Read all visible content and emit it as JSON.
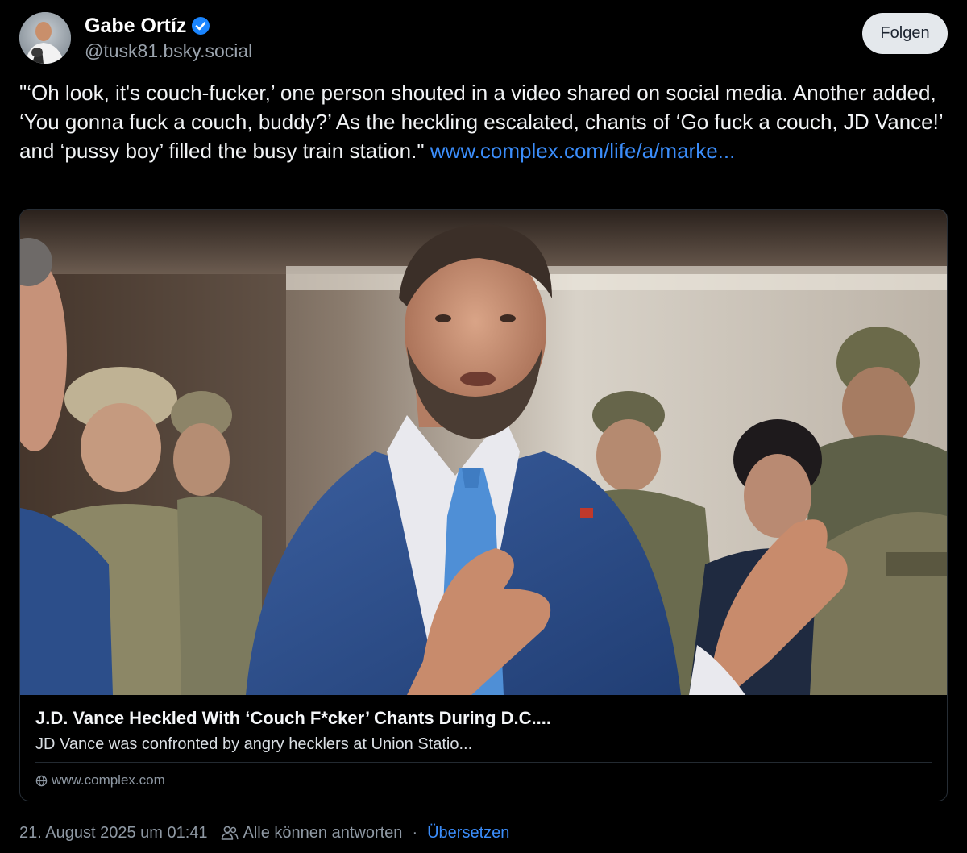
{
  "author": {
    "display_name": "Gabe Ortíz",
    "handle": "@tusk81.bsky.social",
    "verified": true,
    "avatar_icon": "profile-photo"
  },
  "follow_button": {
    "label": "Folgen"
  },
  "post": {
    "text": "\"‘Oh look, it's couch-fucker,’ one person shouted in a video shared on social media. Another added, ‘You gonna fuck a couch, buddy?’ As the heckling escalated, chants of ‘Go fuck a couch, JD Vance!’ and ‘pussy boy’ filled the busy train station.\"",
    "link_text": "www.complex.com/life/a/marke..."
  },
  "embed": {
    "image_icon": "news-photo",
    "title": "J.D. Vance Heckled With ‘Couch F*cker’ Chants During D.C....",
    "description": "JD Vance was confronted by angry hecklers at Union Statio...",
    "domain": "www.complex.com",
    "domain_icon": "globe-icon"
  },
  "footer": {
    "timestamp": "21. August 2025 um 01:41",
    "reply_setting_icon": "people-icon",
    "reply_setting": "Alle können antworten",
    "separator": "·",
    "translate_label": "Übersetzen"
  },
  "colors": {
    "background": "#000000",
    "link": "#3b8dfa",
    "muted_text": "#8e98a3",
    "verified_badge": "#1a85ff",
    "follow_button_bg": "#e4e8ec"
  }
}
